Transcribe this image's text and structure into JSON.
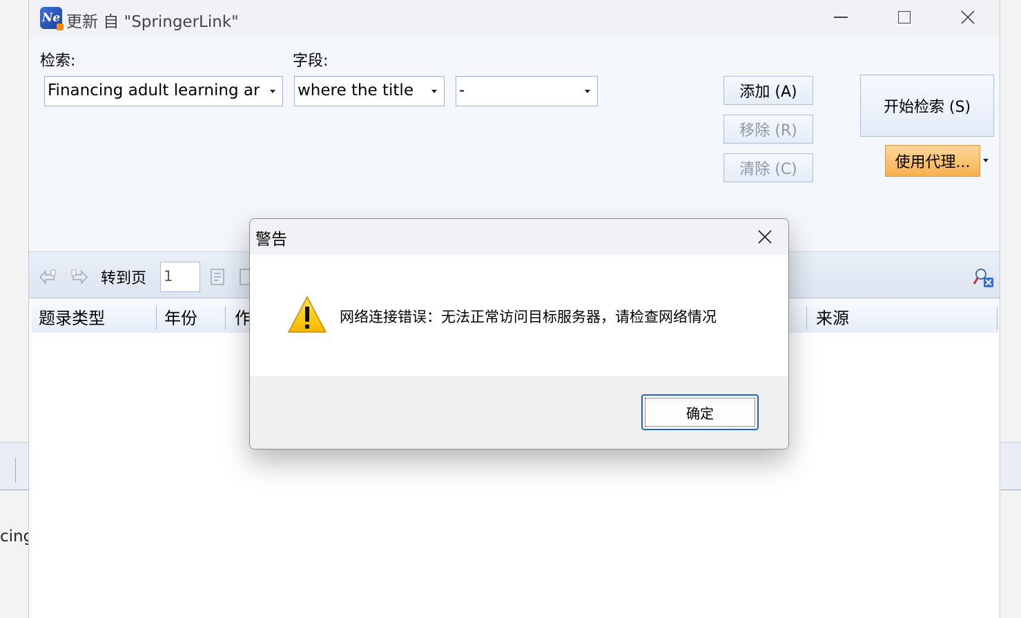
{
  "window": {
    "title": "更新 自 \"SpringerLink\"",
    "app_icon_text": "Ne",
    "close_glyph": "✕"
  },
  "search": {
    "query_label": "检索:",
    "field_label": "字段:",
    "query_value": "Financing adult learning ar",
    "field_value": "where the title",
    "operator_value": "-",
    "add_label": "添加 (A)",
    "remove_label": "移除 (R)",
    "clear_label": "清除 (C)",
    "start_label": "开始检索 (S)",
    "proxy_label": "使用代理..."
  },
  "toolbar": {
    "goto_label": "转到页",
    "page_value": "1"
  },
  "grid": {
    "columns": [
      "题录类型",
      "年份",
      "作",
      "来源"
    ]
  },
  "background": {
    "partial_text": "cing"
  },
  "dialog": {
    "title": "警告",
    "message": "网络连接错误：无法正常访问目标服务器，请检查网络情况",
    "ok_label": "确定"
  },
  "colors": {
    "accent": "#1b64c4",
    "proxy": "#f7b04c",
    "warning": "#f8c800"
  }
}
